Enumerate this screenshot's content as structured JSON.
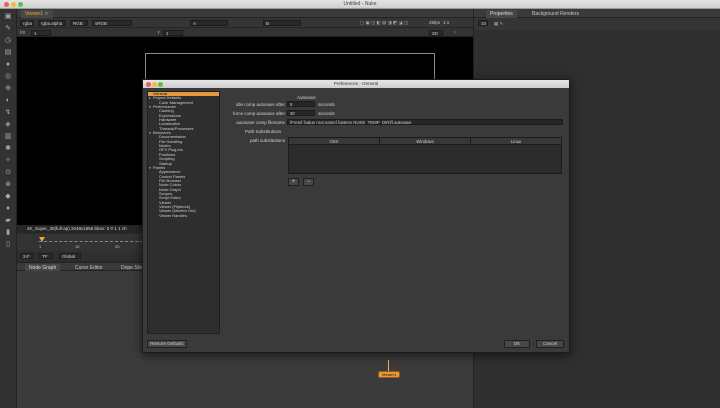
{
  "window": {
    "title": "Untitled - Nuke"
  },
  "viewer": {
    "tab_label": "Viewer1",
    "close_glyph": "✕",
    "channels": "rgba",
    "alpha": "rgba.alpha",
    "colorspace": "RGB",
    "display": "sRGB",
    "input_a": "A",
    "input_b": "B",
    "fps": "25fps",
    "zoom": "1:1",
    "gain_label": "f/8",
    "gain_value": "1",
    "gamma_label": "Y",
    "gamma_value": "1",
    "proxy": "2D",
    "info_text": "2K_Super_35(full-ap) 2048x1556  bbox: 0 0 1 1 ch"
  },
  "timeline": {
    "ticks": [
      "1",
      "10",
      "20"
    ],
    "fps": "24*",
    "tf": "TF",
    "range": "Global"
  },
  "nodegraph": {
    "tabs": [
      "Node Graph",
      "Curve Editor",
      "Dope She"
    ],
    "node_label": "Viewer1"
  },
  "properties": {
    "tabs": [
      "Properties",
      "Background Renders"
    ],
    "count": "10"
  },
  "preferences": {
    "title": "Preferences - General",
    "tree": [
      {
        "label": "General",
        "level": 0,
        "arrow": "▸",
        "selected": true
      },
      {
        "label": "Project Defaults",
        "level": 0,
        "arrow": "▸"
      },
      {
        "label": "Color Management",
        "level": 2,
        "arrow": ""
      },
      {
        "label": "Performance",
        "level": 0,
        "arrow": "▾"
      },
      {
        "label": "Caching",
        "level": 2,
        "arrow": ""
      },
      {
        "label": "Expressions",
        "level": 2,
        "arrow": ""
      },
      {
        "label": "Hardware",
        "level": 2,
        "arrow": ""
      },
      {
        "label": "Localization",
        "level": 2,
        "arrow": ""
      },
      {
        "label": "Threads/Processes",
        "level": 2,
        "arrow": ""
      },
      {
        "label": "Behaviors",
        "level": 0,
        "arrow": "▾"
      },
      {
        "label": "Documentation",
        "level": 2,
        "arrow": ""
      },
      {
        "label": "File Handling",
        "level": 2,
        "arrow": ""
      },
      {
        "label": "Nodes",
        "level": 2,
        "arrow": ""
      },
      {
        "label": "OFX Plug-ins",
        "level": 2,
        "arrow": ""
      },
      {
        "label": "Positions",
        "level": 2,
        "arrow": ""
      },
      {
        "label": "Scripting",
        "level": 2,
        "arrow": ""
      },
      {
        "label": "Startup",
        "level": 2,
        "arrow": ""
      },
      {
        "label": "Panels",
        "level": 0,
        "arrow": "▾"
      },
      {
        "label": "Appearance",
        "level": 2,
        "arrow": ""
      },
      {
        "label": "Control Panels",
        "level": 2,
        "arrow": ""
      },
      {
        "label": "File Browser",
        "level": 2,
        "arrow": ""
      },
      {
        "label": "Node Colors",
        "level": 2,
        "arrow": ""
      },
      {
        "label": "Node Graph",
        "level": 2,
        "arrow": ""
      },
      {
        "label": "Scopes",
        "level": 2,
        "arrow": ""
      },
      {
        "label": "Script Editor",
        "level": 2,
        "arrow": ""
      },
      {
        "label": "Viewer",
        "level": 2,
        "arrow": ""
      },
      {
        "label": "Viewer (Flipbook)",
        "level": 2,
        "arrow": ""
      },
      {
        "label": "Viewer (Monitor Out)",
        "level": 2,
        "arrow": ""
      },
      {
        "label": "Viewer Handles",
        "level": 2,
        "arrow": ""
      }
    ],
    "autosave_heading": "Autosave",
    "idle_label": "idle comp autosave after",
    "idle_value": "5",
    "idle_unit": "seconds",
    "force_label": "force comp autosave after",
    "force_value": "30",
    "force_unit": "seconds",
    "filename_label": "autosave comp filename",
    "filename_value": "[Fretof [value root.name] [getenv NUKE_TEMP_DIR]/].autosave",
    "path_subs_heading": "Path Substitutions",
    "path_subs_label": "path substitutions",
    "table_columns": [
      "OSX",
      "Windows",
      "Linux"
    ],
    "add_glyph": "+",
    "remove_glyph": "−",
    "restore_label": "Restore Defaults",
    "ok_label": "OK",
    "cancel_label": "Cancel"
  },
  "colors": {
    "accent": "#e39a3d",
    "dialog_bg": "#3a3a3a",
    "viewer_bg": "#000000"
  }
}
